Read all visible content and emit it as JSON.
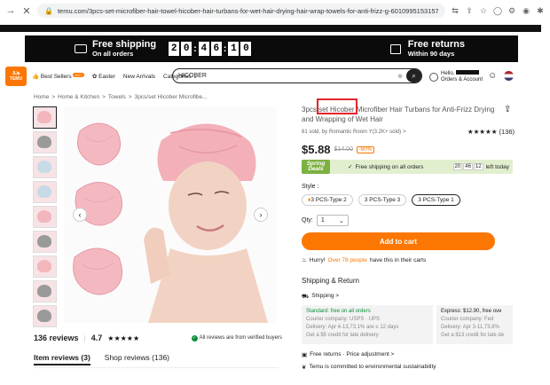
{
  "browser": {
    "url": "temu.com/3pcs-set-microfiber-hair-towel-hicober-hair-turbans-for-wet-hair-drying-hair-wrap-towels-for-anti-frizz-g-601099515315746..."
  },
  "promo": {
    "free_shipping": "Free shipping",
    "on_all_orders": "On all orders",
    "timer": [
      "2",
      "0",
      ":",
      "4",
      "6",
      ":",
      "1",
      "0"
    ],
    "free_returns": "Free returns",
    "within_90": "Within 90 days"
  },
  "header": {
    "logo_line1": "Ꮽᒍᏼ",
    "logo_line2": "TEMU",
    "nav": {
      "best_sellers": "Best Sellers",
      "hot": "HOT",
      "easter": "Easter",
      "new_arrivals": "New Arrivals",
      "categories": "Categories"
    },
    "search_value": "HICOBER",
    "account_hello": "Hello,",
    "account_label": "Orders & Account"
  },
  "breadcrumb": [
    "Home",
    ">",
    "Home & Kitchen",
    ">",
    "Towels",
    ">",
    "3pcs/set Hicober Microfibe..."
  ],
  "reviews": {
    "count": "136 reviews",
    "rating": "4.7",
    "stars": "★★★★★",
    "verified": "All reviews are from verified buyers",
    "tab_item": "Item reviews (3)",
    "tab_shop": "Shop reviews (136)"
  },
  "product": {
    "title": "3pcs/set Hicober Microfiber Hair Turbans for Anti-Frizz Drying and Wrapping of Wet Hair",
    "sold": "61 sold, by",
    "store": "Romantic Room Y(3.2K+ sold)",
    "store_arrow": ">",
    "rating_stars": "★★★★★",
    "rating_count": "(136)",
    "price": "$5.88",
    "old_price": "$14.00",
    "discount": "-60%",
    "spring_label": "Spring Deals",
    "free_shipping": "Free shipping on all orders",
    "mini_timer": [
      "20",
      "46",
      "12"
    ],
    "left_today": "left today",
    "style_label": "Style :",
    "styles": [
      "3 PCS-Type 2",
      "3 PCS-Type 3",
      "3 PCS-Type 1"
    ],
    "qty_label": "Qty:",
    "qty_value": "1",
    "add_to_cart": "Add to cart",
    "hurry": "Hurry!",
    "hurry_count": "Over 78 people",
    "hurry_rest": "have this in their carts",
    "shipping_return": "Shipping & Return",
    "shipping_link": "Shipping >",
    "std_title": "Standard: free on all orders",
    "std_courier": "Courier company: USPS · UPS",
    "std_delivery": "Delivery: Apr 4-13,73.1% are ≤ 12 days",
    "std_credit": "Get a $5 credit for late delivery",
    "exp_title": "Express: $12.90, free ove",
    "exp_courier": "Courier company: Fed",
    "exp_delivery": "Delivery: Apr 3-11,73.8%",
    "exp_credit": "Get a $13 credit for late de",
    "free_returns": "Free returns · Price adjustment >",
    "sustain": "Temu is committed to environmental sustainability"
  }
}
